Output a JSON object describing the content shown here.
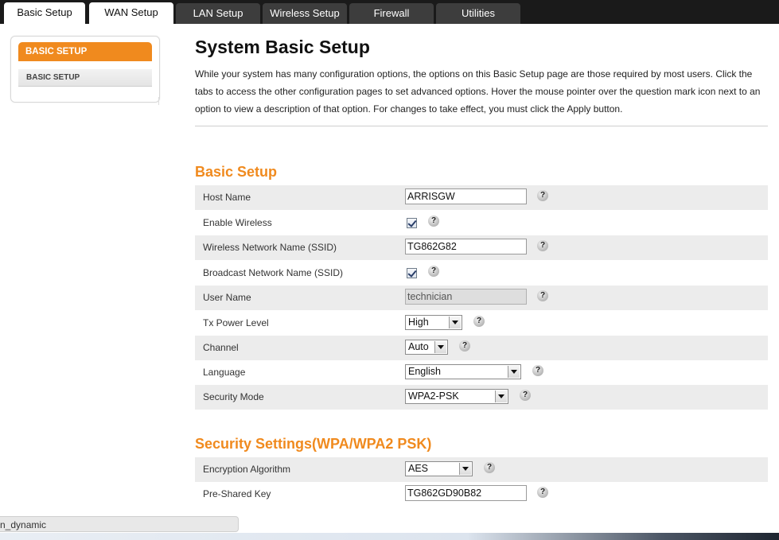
{
  "tabs": [
    {
      "label": "Basic Setup",
      "active": true
    },
    {
      "label": "WAN Setup",
      "active": true
    },
    {
      "label": "LAN Setup",
      "active": false
    },
    {
      "label": "Wireless Setup",
      "active": false
    },
    {
      "label": "Firewall",
      "active": false
    },
    {
      "label": "Utilities",
      "active": false
    }
  ],
  "sidebar": {
    "header": "BASIC SETUP",
    "item": "BASIC SETUP"
  },
  "page": {
    "title": "System Basic Setup",
    "intro": "While your system has many configuration options, the options on this Basic Setup page are those required by most users. Click the tabs to access the other configuration pages to set advanced options. Hover the mouse pointer over the question mark icon next to an option to view a description of that option. For changes to take effect, you must click the Apply button."
  },
  "basic_setup": {
    "title": "Basic Setup",
    "host_name": {
      "label": "Host Name",
      "value": "ARRISGW"
    },
    "enable_wireless": {
      "label": "Enable Wireless",
      "checked": true
    },
    "ssid": {
      "label": "Wireless Network Name (SSID)",
      "value": "TG862G82"
    },
    "broadcast_ssid": {
      "label": "Broadcast Network Name (SSID)",
      "checked": true
    },
    "user_name": {
      "label": "User Name",
      "value": "technician"
    },
    "tx_power": {
      "label": "Tx Power Level",
      "value": "High"
    },
    "channel": {
      "label": "Channel",
      "value": "Auto"
    },
    "language": {
      "label": "Language",
      "value": "English"
    },
    "security_mode": {
      "label": "Security Mode",
      "value": "WPA2-PSK"
    }
  },
  "security_settings": {
    "title": "Security Settings(WPA/WPA2 PSK)",
    "encryption": {
      "label": "Encryption Algorithm",
      "value": "AES"
    },
    "psk": {
      "label": "Pre-Shared Key",
      "value": "TG862GD90B82"
    }
  },
  "help_glyph": "?",
  "status_bar": "n_dynamic",
  "colors": {
    "accent": "#f08a1e",
    "tab_bg": "#3d3d3d",
    "row_shade": "#ececec"
  }
}
